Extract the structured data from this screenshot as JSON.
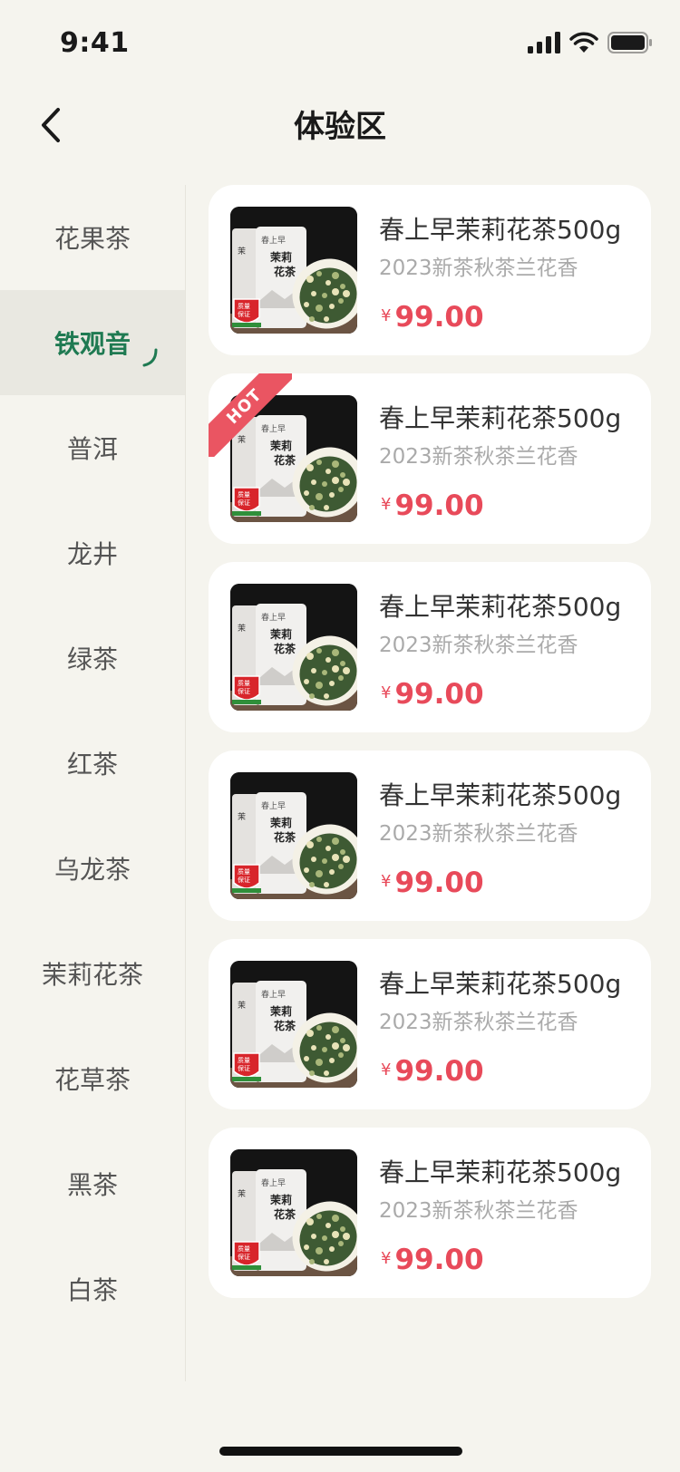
{
  "status_bar": {
    "time": "9:41"
  },
  "nav": {
    "title": "体验区"
  },
  "sidebar": {
    "items": [
      {
        "label": "花果茶"
      },
      {
        "label": "铁观音"
      },
      {
        "label": "普洱"
      },
      {
        "label": "龙井"
      },
      {
        "label": "绿茶"
      },
      {
        "label": "红茶"
      },
      {
        "label": "乌龙茶"
      },
      {
        "label": "茉莉花茶"
      },
      {
        "label": "花草茶"
      },
      {
        "label": "黑茶"
      },
      {
        "label": "白茶"
      }
    ],
    "active_label": "铁观音"
  },
  "products": [
    {
      "name": "春上早茉莉花茶500g",
      "subtitle": "2023新茶秋茶兰花香",
      "currency": "¥",
      "price": "99.00",
      "hot": false
    },
    {
      "name": "春上早茉莉花茶500g",
      "subtitle": "2023新茶秋茶兰花香",
      "currency": "¥",
      "price": "99.00",
      "hot": true,
      "badge_text": "HOT"
    },
    {
      "name": "春上早茉莉花茶500g",
      "subtitle": "2023新茶秋茶兰花香",
      "currency": "¥",
      "price": "99.00",
      "hot": false
    },
    {
      "name": "春上早茉莉花茶500g",
      "subtitle": "2023新茶秋茶兰花香",
      "currency": "¥",
      "price": "99.00",
      "hot": false
    },
    {
      "name": "春上早茉莉花茶500g",
      "subtitle": "2023新茶秋茶兰花香",
      "currency": "¥",
      "price": "99.00",
      "hot": false
    },
    {
      "name": "春上早茉莉花茶500g",
      "subtitle": "2023新茶秋茶兰花香",
      "currency": "¥",
      "price": "99.00",
      "hot": false
    }
  ],
  "product_image": {
    "brand": "春上早",
    "tin_label": "茉莉花茶",
    "seal": "质量保证"
  },
  "colors": {
    "background": "#f5f4ee",
    "accent_green": "#1f7a52",
    "price_red": "#e84a5a",
    "hot_badge": "#ea5562"
  },
  "icons": {
    "back": "chevron-left-icon",
    "signal": "cellular-signal-icon",
    "wifi": "wifi-icon",
    "battery": "battery-icon",
    "active_mark": "curve-mark-icon"
  }
}
